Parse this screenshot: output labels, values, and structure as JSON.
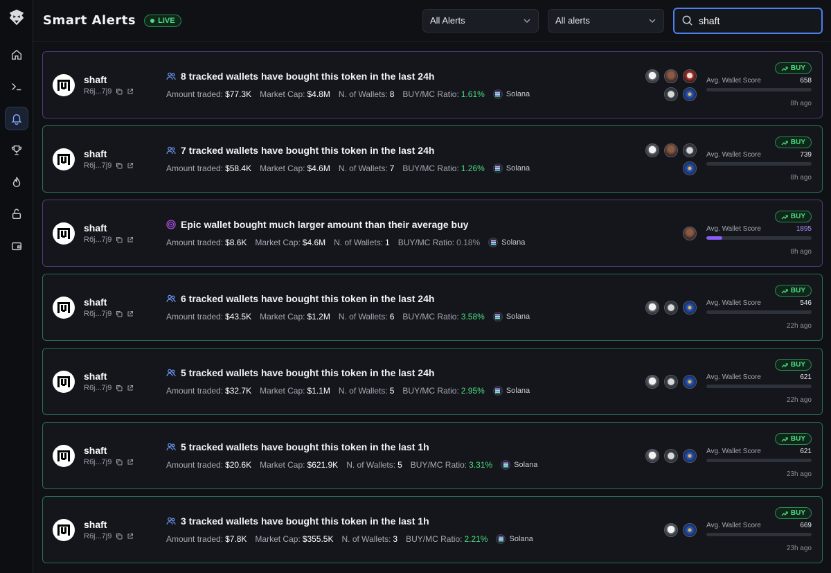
{
  "header": {
    "title": "Smart Alerts",
    "live_label": "LIVE",
    "filter1": "All Alerts",
    "filter2": "All alerts",
    "search_value": "shaft"
  },
  "labels": {
    "amount": "Amount traded:",
    "mcap": "Market Cap:",
    "wallets": "N. of Wallets:",
    "ratio": "BUY/MC Ratio:",
    "score": "Avg. Wallet Score",
    "buy": "BUY"
  },
  "colors": {
    "accent": "#4e7ff0",
    "green": "#4ade80",
    "purple": "#8b5cf6",
    "card_border": "#2c6e58"
  },
  "alerts": [
    {
      "token": "shaft",
      "address": "R6j...7j9",
      "icon": "wallets-icon",
      "headline": "8 tracked wallets have bought this token in the last 24h",
      "amount": "$77.3K",
      "mcap": "$4.8M",
      "wallets": "8",
      "ratio": "1.61%",
      "ratio_style": "green",
      "chain": "Solana",
      "avatars": [
        "skull",
        "brown",
        "red",
        "goggle",
        "blue"
      ],
      "score": "658",
      "score_fraction": 0.0,
      "time": "8h ago",
      "border": "purple"
    },
    {
      "token": "shaft",
      "address": "R6j...7j9",
      "icon": "wallets-icon",
      "headline": "7 tracked wallets have bought this token in the last 24h",
      "amount": "$58.4K",
      "mcap": "$4.6M",
      "wallets": "7",
      "ratio": "1.26%",
      "ratio_style": "green",
      "chain": "Solana",
      "avatars": [
        "skull",
        "brown",
        "goggle",
        "blue"
      ],
      "score": "739",
      "score_fraction": 0.0,
      "time": "8h ago",
      "border": "green"
    },
    {
      "token": "shaft",
      "address": "R6j...7j9",
      "icon": "target-icon",
      "headline": "Epic wallet bought much larger amount than their average buy",
      "amount": "$8.6K",
      "mcap": "$4.6M",
      "wallets": "1",
      "ratio": "0.18%",
      "ratio_style": "neutral",
      "chain": "Solana",
      "avatars": [
        "brown"
      ],
      "score": "1895",
      "score_fraction": 0.15,
      "time": "8h ago",
      "border": "purple"
    },
    {
      "token": "shaft",
      "address": "R6j...7j9",
      "icon": "wallets-icon",
      "headline": "6 tracked wallets have bought this token in the last 24h",
      "amount": "$43.5K",
      "mcap": "$1.2M",
      "wallets": "6",
      "ratio": "3.58%",
      "ratio_style": "green",
      "chain": "Solana",
      "avatars": [
        "skull",
        "goggle",
        "blue"
      ],
      "score": "546",
      "score_fraction": 0.0,
      "time": "22h ago",
      "border": "green"
    },
    {
      "token": "shaft",
      "address": "R6j...7j9",
      "icon": "wallets-icon",
      "headline": "5 tracked wallets have bought this token in the last 24h",
      "amount": "$32.7K",
      "mcap": "$1.1M",
      "wallets": "5",
      "ratio": "2.95%",
      "ratio_style": "green",
      "chain": "Solana",
      "avatars": [
        "skull",
        "goggle",
        "blue"
      ],
      "score": "621",
      "score_fraction": 0.0,
      "time": "22h ago",
      "border": "green"
    },
    {
      "token": "shaft",
      "address": "R6j...7j9",
      "icon": "wallets-icon",
      "headline": "5 tracked wallets have bought this token in the last 1h",
      "amount": "$20.6K",
      "mcap": "$621.9K",
      "wallets": "5",
      "ratio": "3.31%",
      "ratio_style": "green",
      "chain": "Solana",
      "avatars": [
        "skull",
        "goggle",
        "blue"
      ],
      "score": "621",
      "score_fraction": 0.0,
      "time": "23h ago",
      "border": "green"
    },
    {
      "token": "shaft",
      "address": "R6j...7j9",
      "icon": "wallets-icon",
      "headline": "3 tracked wallets have bought this token in the last 1h",
      "amount": "$7.8K",
      "mcap": "$355.5K",
      "wallets": "3",
      "ratio": "2.21%",
      "ratio_style": "green",
      "chain": "Solana",
      "avatars": [
        "skull",
        "blue"
      ],
      "score": "669",
      "score_fraction": 0.0,
      "time": "23h ago",
      "border": "green"
    }
  ]
}
